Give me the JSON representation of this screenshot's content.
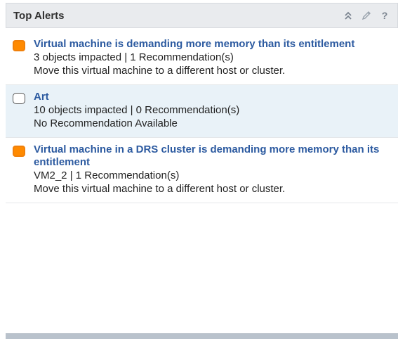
{
  "header": {
    "title": "Top Alerts"
  },
  "alerts": [
    {
      "status": "critical",
      "title": "Virtual machine is demanding more memory than its entitlement",
      "impact": "3 objects impacted | 1 Recommendation(s)",
      "recommendation": "Move this virtual machine to a different host or cluster."
    },
    {
      "status": "none",
      "title": "Art",
      "impact": "10 objects impacted | 0 Recommendation(s)",
      "recommendation": "No Recommendation Available"
    },
    {
      "status": "critical",
      "title": "Virtual machine in a DRS cluster is demanding more memory than its entitlement",
      "impact": "VM2_2 | 1 Recommendation(s)",
      "recommendation": "Move this virtual machine to a different host or cluster."
    }
  ],
  "colors": {
    "critical": "#ff8a00",
    "link": "#2c5aa0",
    "selected_bg": "#e9f2f8"
  },
  "icons": [
    "collapse-icon",
    "edit-icon",
    "help-icon"
  ]
}
